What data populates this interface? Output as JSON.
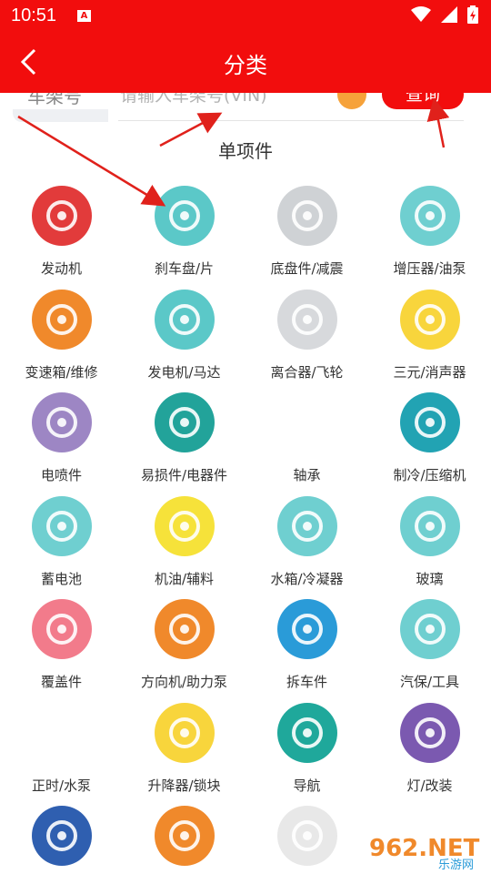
{
  "status_bar": {
    "time": "10:51",
    "app_badge": "A"
  },
  "header": {
    "title": "分类"
  },
  "search": {
    "vin_label": "车架号",
    "vin_placeholder": "请输入车架号(VIN)",
    "query_label": "查询"
  },
  "section": {
    "title": "单项件"
  },
  "categories": [
    {
      "label": "发动机",
      "icon": "engine-icon",
      "color": "#e23b3b"
    },
    {
      "label": "刹车盘/片",
      "icon": "brake-disc-icon",
      "color": "#5bc8c8"
    },
    {
      "label": "底盘件/减震",
      "icon": "chassis-shock-icon",
      "color": "#cfd2d5"
    },
    {
      "label": "增压器/油泵",
      "icon": "turbocharger-icon",
      "color": "#6fcfd0"
    },
    {
      "label": "变速箱/维修",
      "icon": "gearbox-icon",
      "color": "#f0892b"
    },
    {
      "label": "发电机/马达",
      "icon": "alternator-icon",
      "color": "#5bc8c8"
    },
    {
      "label": "离合器/飞轮",
      "icon": "clutch-icon",
      "color": "#d7d9dc"
    },
    {
      "label": "三元/消声器",
      "icon": "muffler-icon",
      "color": "#f8d53c"
    },
    {
      "label": "电喷件",
      "icon": "spark-plug-icon",
      "color": "#9d86c4"
    },
    {
      "label": "易损件/电器件",
      "icon": "rotor-icon",
      "color": "#22a39a"
    },
    {
      "label": "轴承",
      "icon": "wheel-bearing-icon",
      "color": "#ffffff"
    },
    {
      "label": "制冷/压缩机",
      "icon": "cooling-fan-icon",
      "color": "#22a3b3"
    },
    {
      "label": "蓄电池",
      "icon": "battery-icon",
      "color": "#6fcfd0"
    },
    {
      "label": "机油/辅料",
      "icon": "oil-can-icon",
      "color": "#f6e23a"
    },
    {
      "label": "水箱/冷凝器",
      "icon": "radiator-icon",
      "color": "#6fcfd0"
    },
    {
      "label": "玻璃",
      "icon": "windshield-icon",
      "color": "#6fcfd0"
    },
    {
      "label": "覆盖件",
      "icon": "car-door-icon",
      "color": "#f27b8b"
    },
    {
      "label": "方向机/助力泵",
      "icon": "steering-wheel-icon",
      "color": "#f0892b"
    },
    {
      "label": "拆车件",
      "icon": "recycle-icon",
      "color": "#2a9bd8"
    },
    {
      "label": "汽保/工具",
      "icon": "tools-icon",
      "color": "#6fcfd0"
    },
    {
      "label": "正时/水泵",
      "icon": "timing-belt-icon",
      "color": "#ffffff"
    },
    {
      "label": "升降器/锁块",
      "icon": "lift-icon",
      "color": "#f8d53c"
    },
    {
      "label": "导航",
      "icon": "location-pin-icon",
      "color": "#1fa89b"
    },
    {
      "label": "灯/改装",
      "icon": "headlight-icon",
      "color": "#7b59b0"
    },
    {
      "label": "",
      "icon": "drive-shaft-icon",
      "color": "#2f5fb0"
    },
    {
      "label": "",
      "icon": "bumper-icon",
      "color": "#f0892b"
    },
    {
      "label": "",
      "icon": "tire-icon",
      "color": "#e8e8e8"
    }
  ],
  "watermark": {
    "brand": "962.NET",
    "sub": "乐游网"
  }
}
